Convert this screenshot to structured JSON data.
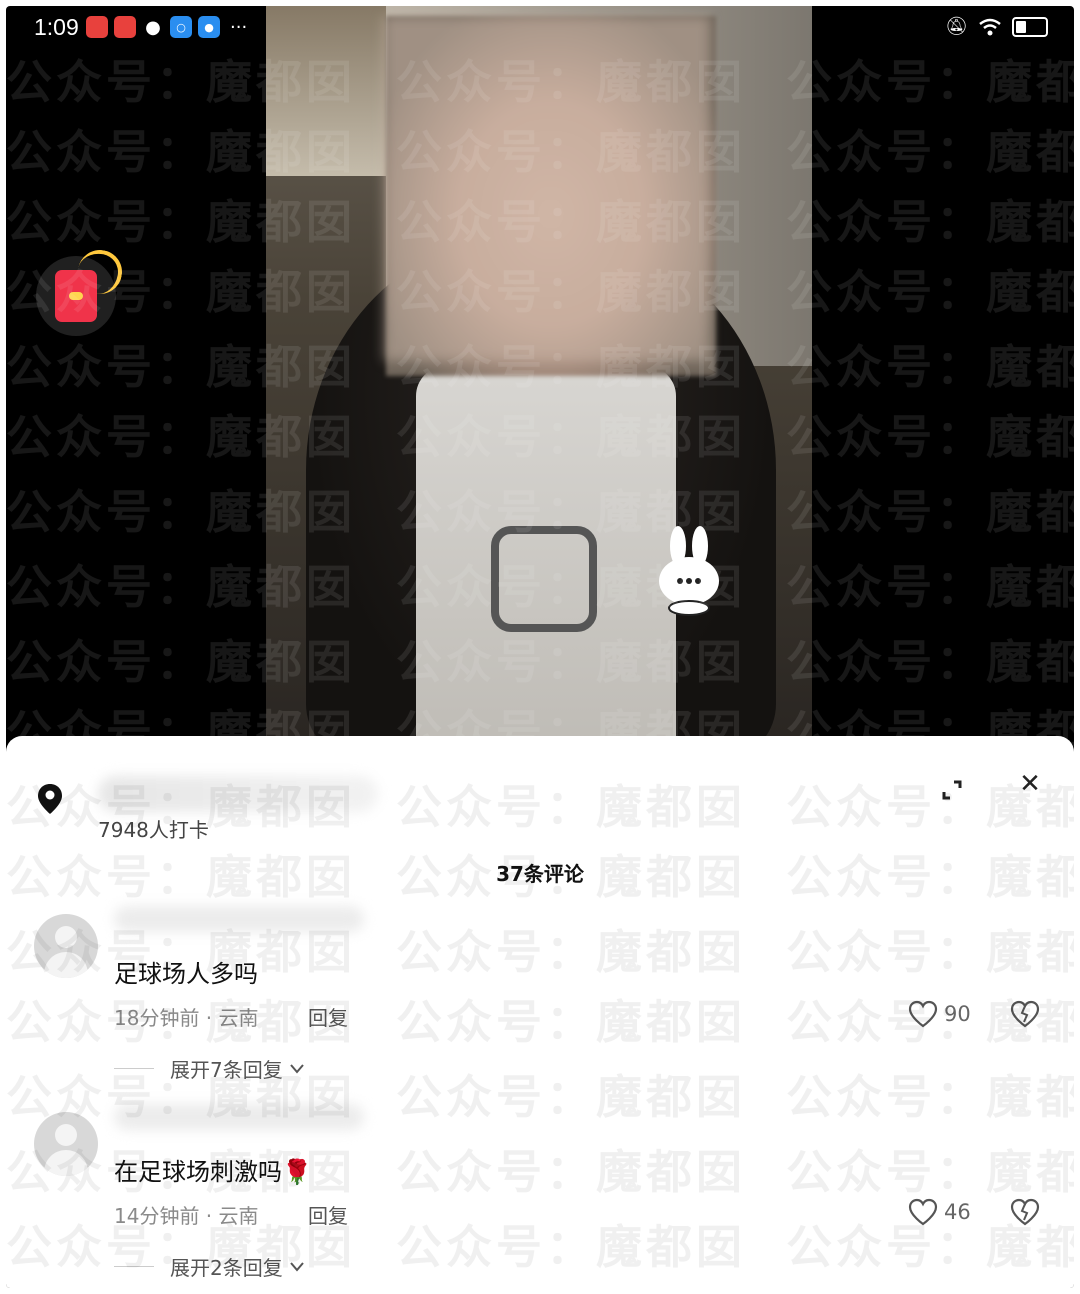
{
  "status_bar": {
    "time": "1:09",
    "more": "···"
  },
  "location": {
    "checkins": "7948人打卡"
  },
  "sheet": {
    "comment_count": "37条评论"
  },
  "comments": [
    {
      "text": "足球场人多吗",
      "meta": "18分钟前 · 云南",
      "reply_label": "回复",
      "likes": "90",
      "expand_label": "展开7条回复"
    },
    {
      "text": "在足球场刺激吗🌹",
      "meta": "14分钟前 · 云南",
      "reply_label": "回复",
      "likes": "46",
      "expand_label": "展开2条回复"
    }
  ],
  "watermark": {
    "text": "公众号：魔都囡"
  },
  "colors": {
    "red_packet": "#f0334a",
    "sheet_bg": "#ffffff",
    "video_bg": "#000000"
  }
}
